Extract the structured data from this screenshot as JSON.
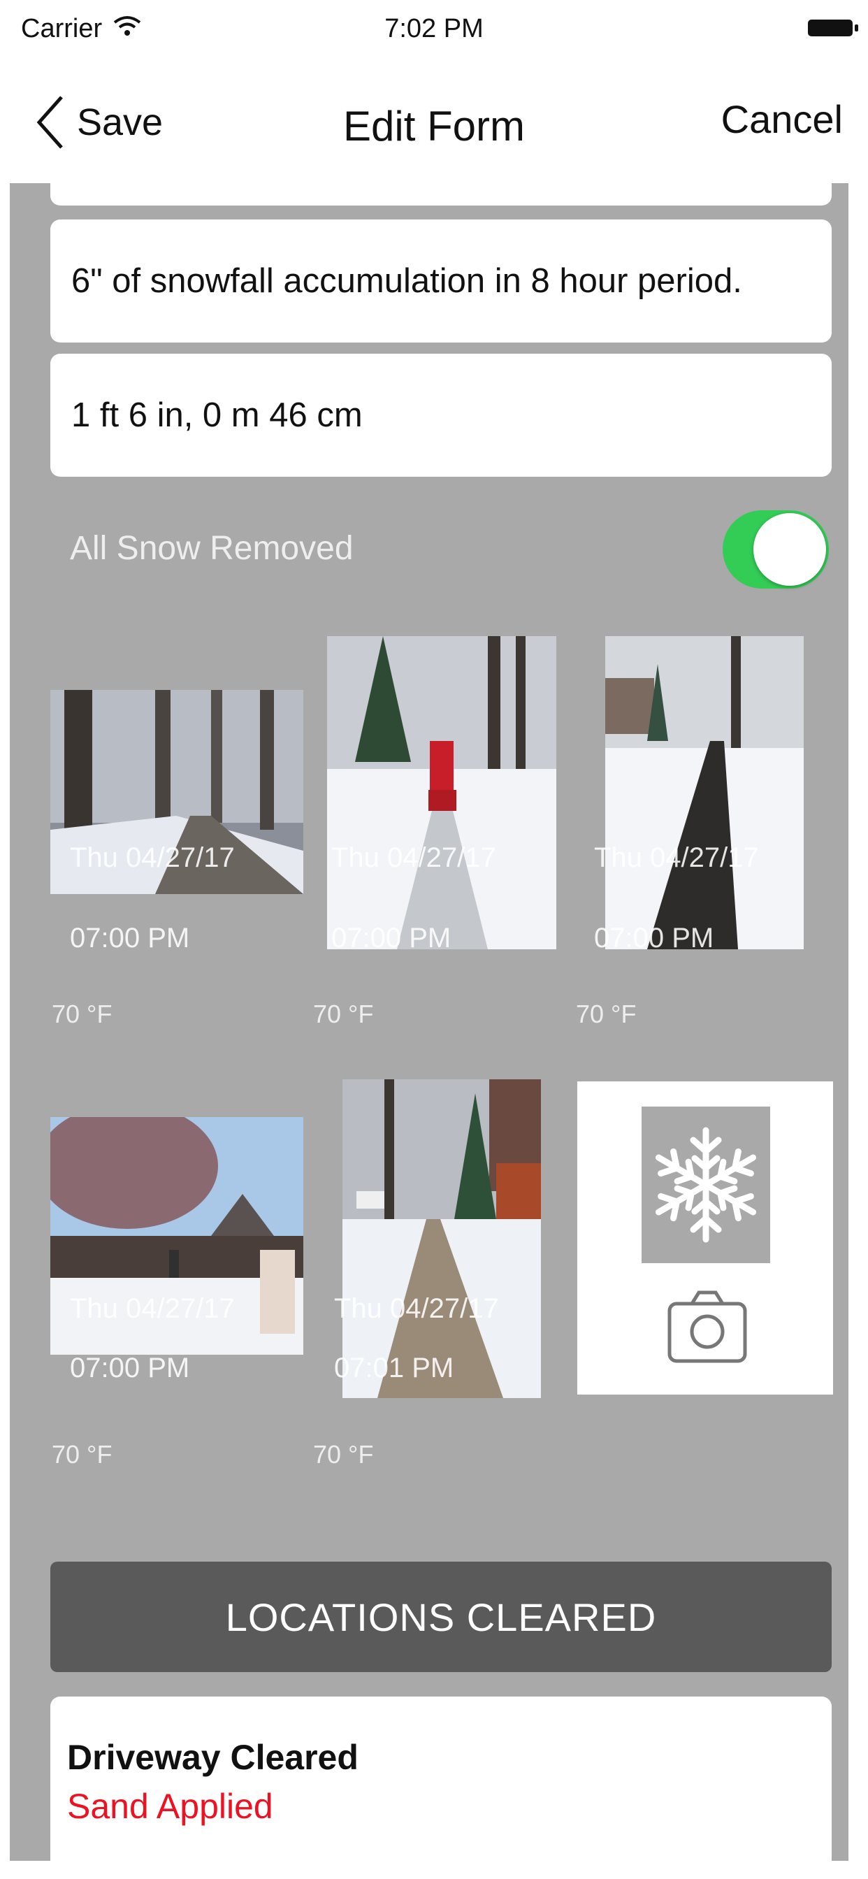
{
  "status_bar": {
    "carrier": "Carrier",
    "time": "7:02 PM"
  },
  "nav": {
    "back_label": "Save",
    "title": "Edit Form",
    "cancel_label": "Cancel"
  },
  "fields": {
    "snowfall_text": "6\" of snowfall accumulation in 8 hour period.",
    "depth_text": "1 ft 6 in, 0 m 46 cm"
  },
  "toggle": {
    "label": "All Snow Removed",
    "on": true
  },
  "photos": [
    {
      "date": "Thu 04/27/17",
      "time": "07:00 PM",
      "temp": "70 °F",
      "scene": "snowy-road"
    },
    {
      "date": "Thu 04/27/17",
      "time": "07:00 PM",
      "temp": "70 °F",
      "scene": "snowblower"
    },
    {
      "date": "Thu 04/27/17",
      "time": "07:00 PM",
      "temp": "70 °F",
      "scene": "cleared-sidewalk"
    },
    {
      "date": "Thu 04/27/17",
      "time": "07:00 PM",
      "temp": "70 °F",
      "scene": "snowy-yard"
    },
    {
      "date": "Thu 04/27/17",
      "time": "07:01 PM",
      "temp": "70 °F",
      "scene": "walkway"
    }
  ],
  "add_photo": {
    "icons": [
      "snowflake-icon",
      "camera-icon"
    ]
  },
  "locations": {
    "header": "LOCATIONS CLEARED",
    "items": [
      {
        "title": "Driveway Cleared",
        "subtitle": "Sand Applied"
      }
    ]
  },
  "colors": {
    "toggle_on": "#33cc55",
    "background": "#a9a9a9",
    "section_bar": "#5a5a5a",
    "alert_text": "#ee1122"
  }
}
